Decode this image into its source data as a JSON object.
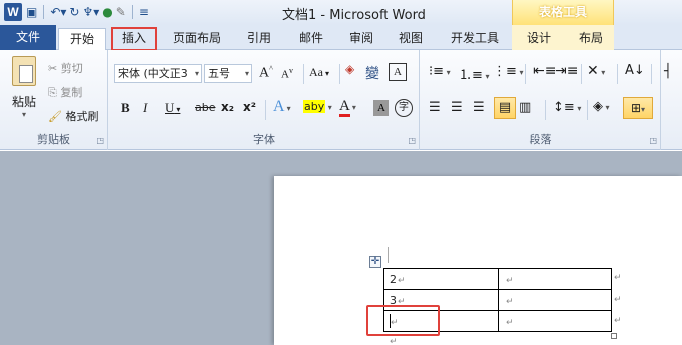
{
  "titlebar": {
    "app_icon": "W",
    "title": "文档1 - Microsoft Word",
    "context_group": "表格工具",
    "qat_icons": [
      "save-icon",
      "undo-icon",
      "redo-icon",
      "format-painter-icon",
      "color-icon",
      "edit-icon",
      "customize-icon"
    ]
  },
  "tabs": {
    "file": "文件",
    "home": "开始",
    "insert": "插入",
    "page_layout": "页面布局",
    "references": "引用",
    "mailings": "邮件",
    "review": "审阅",
    "view": "视图",
    "developer": "开发工具",
    "design": "设计",
    "layout": "布局"
  },
  "clipboard": {
    "paste": "粘贴",
    "cut": "剪切",
    "copy": "复制",
    "format_painter": "格式刷",
    "label": "剪贴板"
  },
  "font": {
    "font_name": "宋体 (中文正3",
    "font_size": "五号",
    "label": "字体",
    "grow": "A",
    "shrink": "A",
    "case": "Aa",
    "bold": "B",
    "italic": "I",
    "underline": "U",
    "strikethrough": "abe",
    "subscript": "x₂",
    "superscript": "x²",
    "phonetic": "變",
    "border_char": "A",
    "highlight": "aby",
    "font_color": "A",
    "char_shading": "A",
    "enclose": "字"
  },
  "paragraph": {
    "label": "段落"
  },
  "document": {
    "table_rows": [
      [
        "2",
        ""
      ],
      [
        "3",
        ""
      ],
      [
        "",
        ""
      ]
    ],
    "paragraph_mark": "↵"
  }
}
